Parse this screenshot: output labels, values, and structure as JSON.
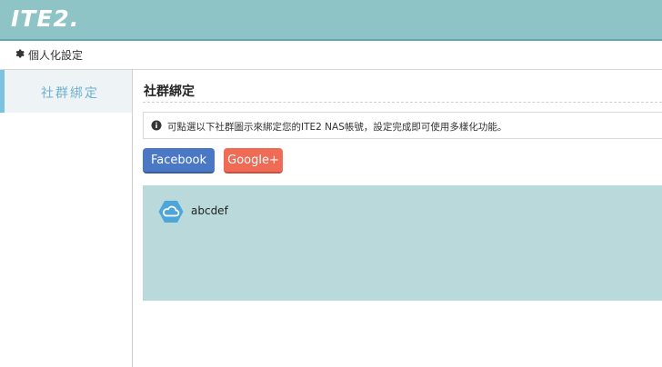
{
  "header": {
    "logo_text": "ITE2."
  },
  "subbar": {
    "icon": "gear-icon",
    "title": "個人化設定"
  },
  "sidebar": {
    "items": [
      {
        "label": "社群綁定",
        "active": true
      }
    ]
  },
  "main": {
    "section_title": "社群綁定",
    "info_icon": "info-circle-icon",
    "info_text": "可點選以下社群圖示來綁定您的ITE2 NAS帳號，設定完成即可使用多樣化功能。",
    "buttons": {
      "facebook": "Facebook",
      "google": "Google+"
    },
    "accounts": [
      {
        "icon": "cloud-icon",
        "name": "abcdef"
      }
    ]
  },
  "colors": {
    "topbar": "#8fc4c6",
    "facebook": "#4a78c4",
    "google": "#ef6b56",
    "accounts_bg": "#bad9da",
    "sidebar_active_text": "#6fb0cf"
  }
}
